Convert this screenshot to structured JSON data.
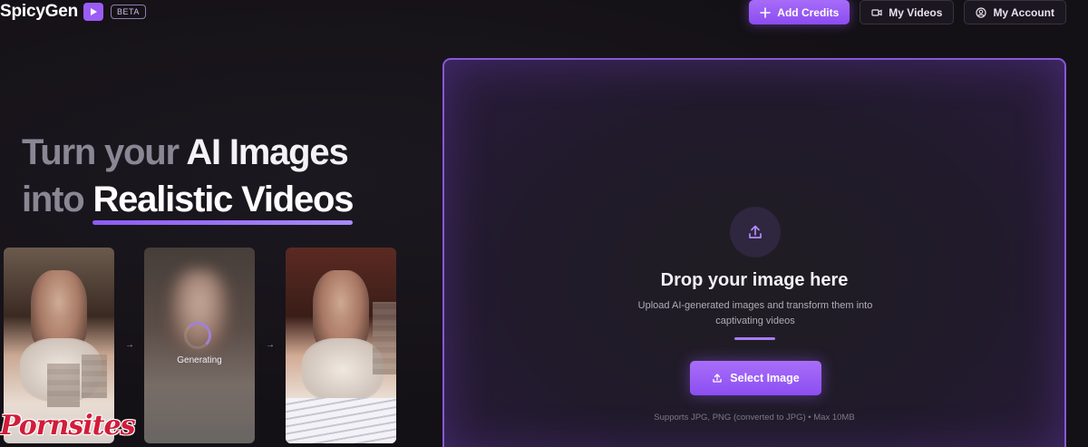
{
  "header": {
    "logo_text": "SpicyGen",
    "badge": "BETA",
    "nav": {
      "add_credits": "Add Credits",
      "my_videos": "My Videos",
      "my_account": "My Account"
    }
  },
  "hero": {
    "line1_muted": "Turn your",
    "line1_bright": "AI Images",
    "line2_muted": "into",
    "line2_highlight": "Realistic Videos"
  },
  "demo": {
    "generating_label": "Generating",
    "arrow_glyph": "→"
  },
  "upload": {
    "title": "Drop your image here",
    "description": "Upload AI-generated images and transform them into captivating videos",
    "button_label": "Select Image",
    "note": "Supports JPG, PNG (converted to JPG) • Max 10MB"
  },
  "watermark": "Pornsites",
  "colors": {
    "accent": "#9b5cf6",
    "background": "#141116",
    "panel_border": "#8758d8"
  },
  "icons": [
    "play-icon",
    "plus-icon",
    "video-camera-icon",
    "user-circle-icon",
    "upload-icon",
    "spinner-icon",
    "arrow-right-icon"
  ]
}
